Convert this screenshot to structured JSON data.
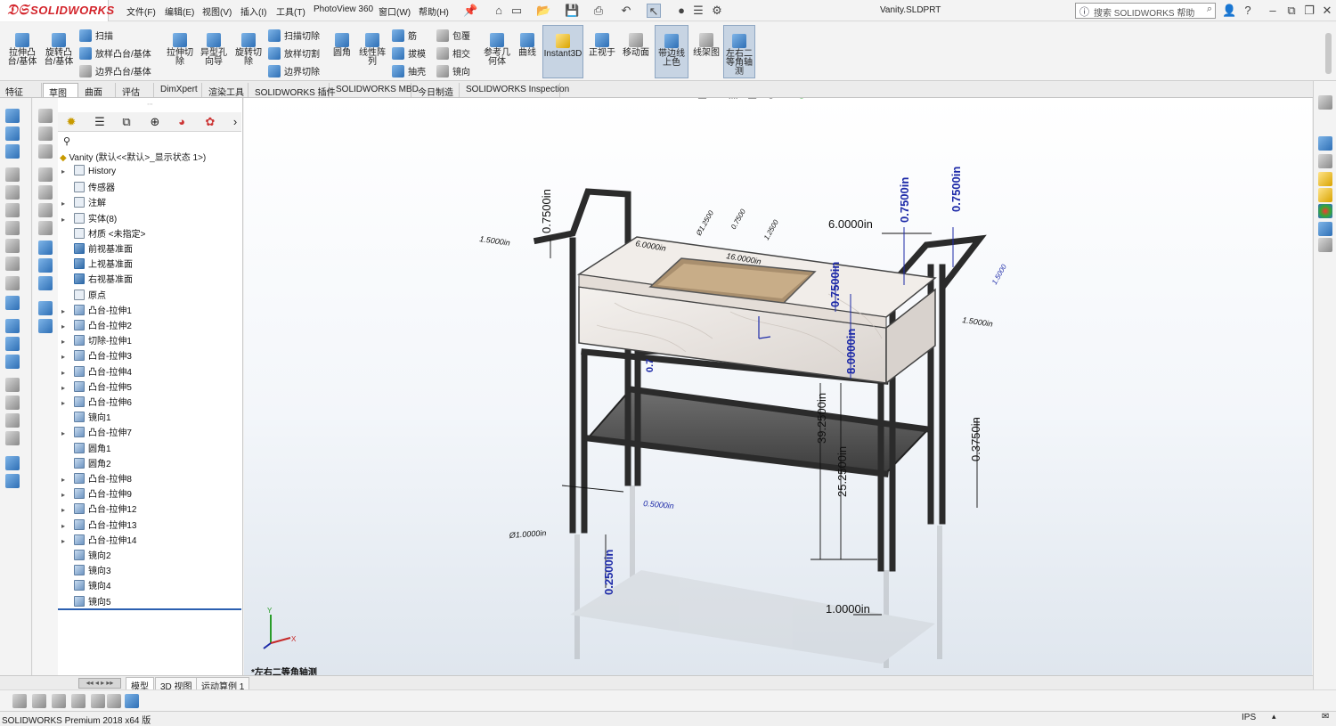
{
  "app": {
    "brand": "SOLIDWORKS",
    "document_title": "Vanity.SLDPRT"
  },
  "menu": [
    "文件(F)",
    "编辑(E)",
    "视图(V)",
    "插入(I)",
    "工具(T)",
    "PhotoView 360",
    "窗口(W)",
    "帮助(H)"
  ],
  "search": {
    "placeholder": "搜索 SOLIDWORKS 帮助"
  },
  "commands": {
    "big": [
      {
        "label": "拉伸凸\n台/基体"
      },
      {
        "label": "旋转凸\n台/基体"
      },
      {
        "label": "拉伸切\n除"
      },
      {
        "label": "异型孔\n向导"
      },
      {
        "label": "旋转切\n除"
      },
      {
        "label": "圆角"
      },
      {
        "label": "线性阵\n列"
      },
      {
        "label": "参考几\n何体"
      },
      {
        "label": "曲线"
      },
      {
        "label": "Instant3D"
      },
      {
        "label": "正视于"
      },
      {
        "label": "移动面"
      },
      {
        "label": "带边线\n上色"
      },
      {
        "label": "线架图"
      },
      {
        "label": "左右二\n等角轴\n测"
      }
    ],
    "small_col1": [
      "扫描",
      "放样凸台/基体",
      "边界凸台/基体"
    ],
    "small_col2": [
      "扫描切除",
      "放样切割",
      "边界切除"
    ],
    "small_col3": [
      "筋",
      "拔模",
      "抽壳"
    ],
    "small_col4": [
      "包覆",
      "相交",
      "镜向"
    ]
  },
  "tabs": [
    "特征",
    "草图",
    "曲面",
    "评估",
    "DimXpert",
    "渲染工具",
    "SOLIDWORKS 插件",
    "SOLIDWORKS MBD",
    "今日制造",
    "SOLIDWORKS Inspection"
  ],
  "tree": {
    "root": "Vanity  (默认<<默认>_显示状态 1>)",
    "nodes": [
      {
        "label": "History",
        "expand": "▸",
        "kind": "folder"
      },
      {
        "label": "传感器",
        "expand": "",
        "kind": "folder"
      },
      {
        "label": "注解",
        "expand": "▸",
        "kind": "folder"
      },
      {
        "label": "实体(8)",
        "expand": "▸",
        "kind": "folder"
      },
      {
        "label": "材质 <未指定>",
        "expand": "",
        "kind": "folder"
      },
      {
        "label": "前视基准面",
        "expand": "",
        "kind": "plane"
      },
      {
        "label": "上视基准面",
        "expand": "",
        "kind": "plane"
      },
      {
        "label": "右视基准面",
        "expand": "",
        "kind": "plane"
      },
      {
        "label": "原点",
        "expand": "",
        "kind": "folder"
      },
      {
        "label": "凸台-拉伸1",
        "expand": "▸",
        "kind": "feat"
      },
      {
        "label": "凸台-拉伸2",
        "expand": "▸",
        "kind": "feat"
      },
      {
        "label": "切除-拉伸1",
        "expand": "▸",
        "kind": "feat"
      },
      {
        "label": "凸台-拉伸3",
        "expand": "▸",
        "kind": "feat"
      },
      {
        "label": "凸台-拉伸4",
        "expand": "▸",
        "kind": "feat"
      },
      {
        "label": "凸台-拉伸5",
        "expand": "▸",
        "kind": "feat"
      },
      {
        "label": "凸台-拉伸6",
        "expand": "▸",
        "kind": "feat"
      },
      {
        "label": "镜向1",
        "expand": "",
        "kind": "feat"
      },
      {
        "label": "凸台-拉伸7",
        "expand": "▸",
        "kind": "feat"
      },
      {
        "label": "圆角1",
        "expand": "",
        "kind": "feat"
      },
      {
        "label": "圆角2",
        "expand": "",
        "kind": "feat"
      },
      {
        "label": "凸台-拉伸8",
        "expand": "▸",
        "kind": "feat"
      },
      {
        "label": "凸台-拉伸9",
        "expand": "▸",
        "kind": "feat"
      },
      {
        "label": "凸台-拉伸12",
        "expand": "▸",
        "kind": "feat"
      },
      {
        "label": "凸台-拉伸13",
        "expand": "▸",
        "kind": "feat"
      },
      {
        "label": "凸台-拉伸14",
        "expand": "▸",
        "kind": "feat"
      },
      {
        "label": "镜向2",
        "expand": "",
        "kind": "feat"
      },
      {
        "label": "镜向3",
        "expand": "",
        "kind": "feat"
      },
      {
        "label": "镜向4",
        "expand": "",
        "kind": "feat"
      },
      {
        "label": "镜向5",
        "expand": "",
        "kind": "feat"
      }
    ]
  },
  "viewport": {
    "view_name": "*左右二等角轴测",
    "dimensions": {
      "d_top_width": "6.0000in",
      "d_height_r1": "0.7500in",
      "d_height_r2": "0.7500in",
      "d_left_top": "0.7500in",
      "d_left_side": "1.5000in",
      "d_right_side": "1.5000in",
      "d_inner_h": "0.7500in",
      "d_body_h": "8.0000in",
      "d_total_h": "39.2500in",
      "d_shelf_h": "25.2500in",
      "d_foot_r": "0.3750in",
      "d_foot_l": "0.2500in",
      "d_bottom": "1.0000in",
      "d_left_low": "0.5000in",
      "d_left_dia": "Ø1.0000in",
      "d_top_left": "6.0000in",
      "d_sink_w": "16.0000in",
      "d_small_a": "Ø1.2500",
      "d_small_b": "0.7500",
      "d_small_c": "1.2500",
      "d_small_d": "1.5000",
      "d_blue_small": "0.7"
    }
  },
  "bottom_tabs": [
    "模型",
    "3D 视图",
    "运动算例 1"
  ],
  "status": {
    "left": "SOLIDWORKS Premium 2018 x64 版",
    "units": "IPS"
  },
  "colors": {
    "brand": "#d3242b",
    "dimension_blue": "#1d2aa8",
    "frame": "#2b2b2b"
  }
}
